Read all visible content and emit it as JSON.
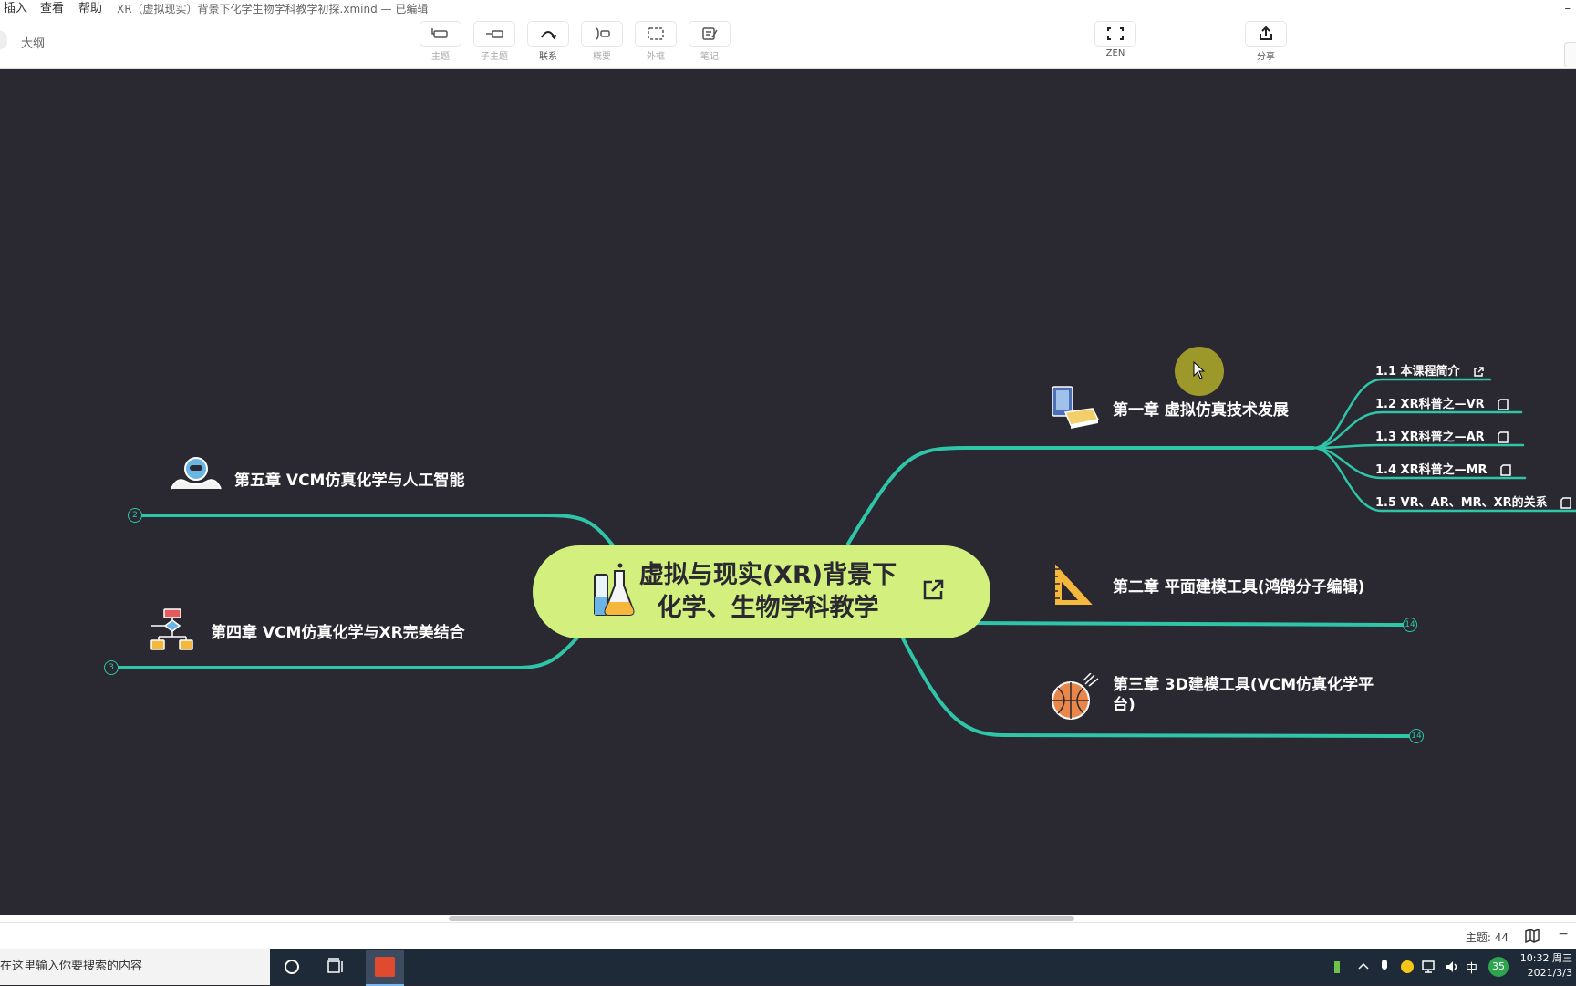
{
  "menu": {
    "items": [
      "插入",
      "查看",
      "帮助"
    ],
    "doc_title": "XR（虚拟现实）背景下化学生物学科教学初探.xmind — 已编辑",
    "minimize": "–"
  },
  "toolbar": {
    "outline_label": "大纲",
    "tools": [
      {
        "label": "主题",
        "icon": "topic-icon",
        "active": false
      },
      {
        "label": "子主题",
        "icon": "subtopic-icon",
        "active": false
      },
      {
        "label": "联系",
        "icon": "relationship-icon",
        "active": true
      },
      {
        "label": "概要",
        "icon": "summary-icon",
        "active": false
      },
      {
        "label": "外框",
        "icon": "boundary-icon",
        "active": false
      },
      {
        "label": "笔记",
        "icon": "note-icon",
        "active": false
      }
    ],
    "zen_label": "ZEN",
    "share_label": "分享"
  },
  "mindmap": {
    "central": {
      "text": "虚拟与现实(XR)背景下化学、生物学科教学",
      "icon": "flask-icon",
      "link_icon": "external-link-icon"
    },
    "chapters": {
      "ch1": {
        "title": "第一章 虚拟仿真技术发展",
        "icon": "book-icon"
      },
      "ch2": {
        "title": "第二章 平面建模工具(鸿鹄分子编辑)",
        "icon": "triangle-ruler-icon",
        "count": "14"
      },
      "ch3": {
        "title": "第三章 3D建模工具(VCM仿真化学平台)",
        "icon": "basketball-icon",
        "count": "14"
      },
      "ch4": {
        "title": "第四章 VCM仿真化学与XR完美结合",
        "icon": "flowchart-icon",
        "count": "3"
      },
      "ch5": {
        "title": "第五章 VCM仿真化学与人工智能",
        "icon": "robot-icon",
        "count": "2"
      }
    },
    "subtopics": [
      {
        "text": "1.1 本课程简介",
        "icon": "external-link-icon"
      },
      {
        "text": "1.2 XR科普之—VR",
        "icon": "note-icon"
      },
      {
        "text": "1.3 XR科普之—AR",
        "icon": "note-icon"
      },
      {
        "text": "1.4 XR科普之—MR",
        "icon": "note-icon"
      },
      {
        "text": "1.5 VR、AR、MR、XR的关系",
        "icon": "note-icon"
      }
    ],
    "line_color": "#2ec5a8",
    "central_color": "#d3f07e",
    "canvas_color": "#2a2830"
  },
  "status": {
    "topic_count": "主题: 44",
    "zoom_out": "−"
  },
  "taskbar": {
    "search_placeholder": "在这里输入你要搜索的内容",
    "ime": "中",
    "badge": "35",
    "time": "10:32 周三",
    "date": "2021/3/3"
  }
}
